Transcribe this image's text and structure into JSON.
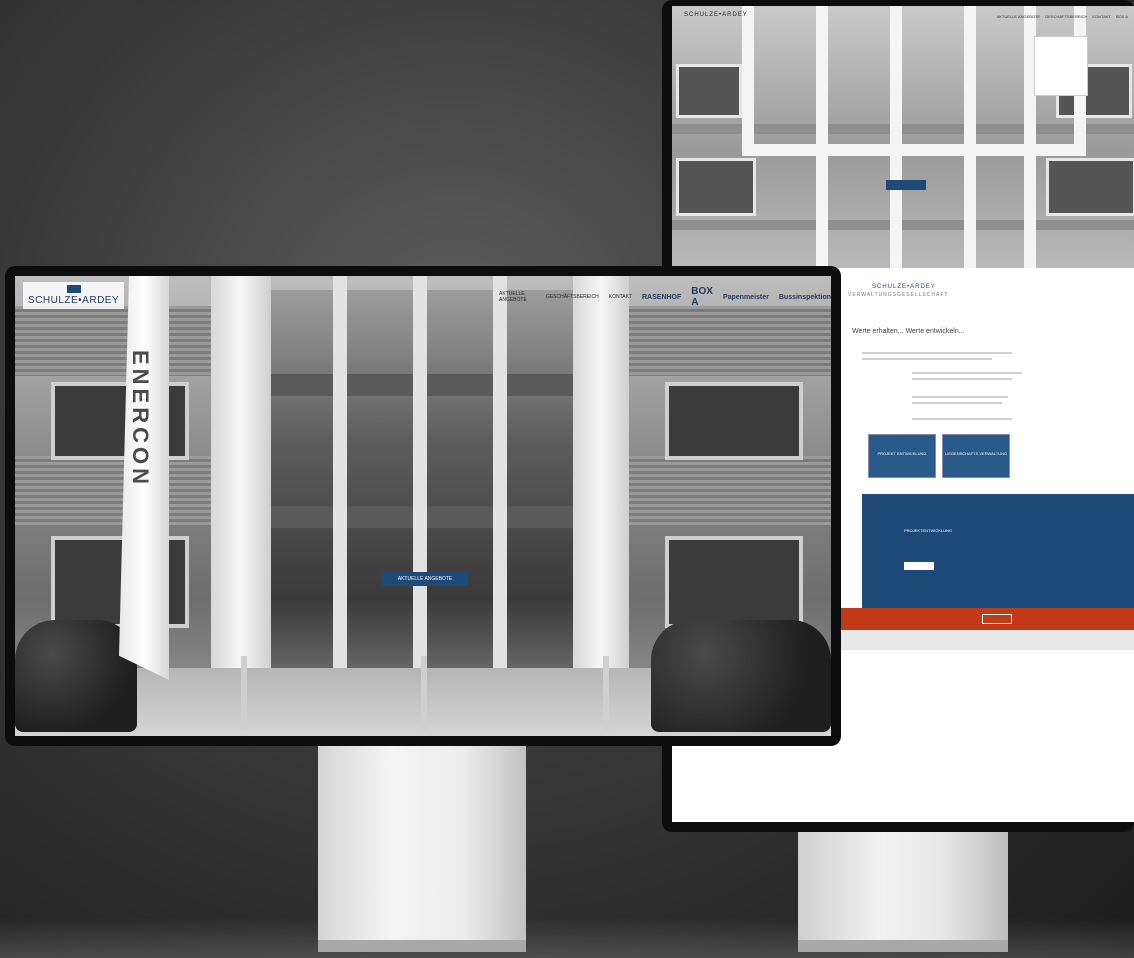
{
  "front_site": {
    "logo": {
      "name": "SCHULZE•ARDEY"
    },
    "nav": {
      "items": [
        "Aktuelle Angebote",
        "Geschäftsbereich",
        "Kontakt"
      ],
      "brands": [
        "RASENHOF",
        "BOX A",
        "Papenmeister",
        "Bussinspektion"
      ]
    },
    "hero_cta": "Aktuelle Angebote",
    "building_sign": "ENERCON"
  },
  "back_site": {
    "logo": "SCHULZE•ARDEY",
    "brand_title": "SCHULZE•ARDEY",
    "brand_subtitle": "VERWALTUNGSGESELLSCHAFT",
    "heading": "Werte erhalten... Werte entwickeln...",
    "tiles": [
      "PROJEKT ENTWICKLUNG",
      "LIEGENSCHAFTS VERWALTUNG"
    ],
    "section_title": "PROJEKTENTWICKLUNG",
    "colors": {
      "brand_blue": "#1e4a7a",
      "accent_red": "#c43a16"
    }
  }
}
